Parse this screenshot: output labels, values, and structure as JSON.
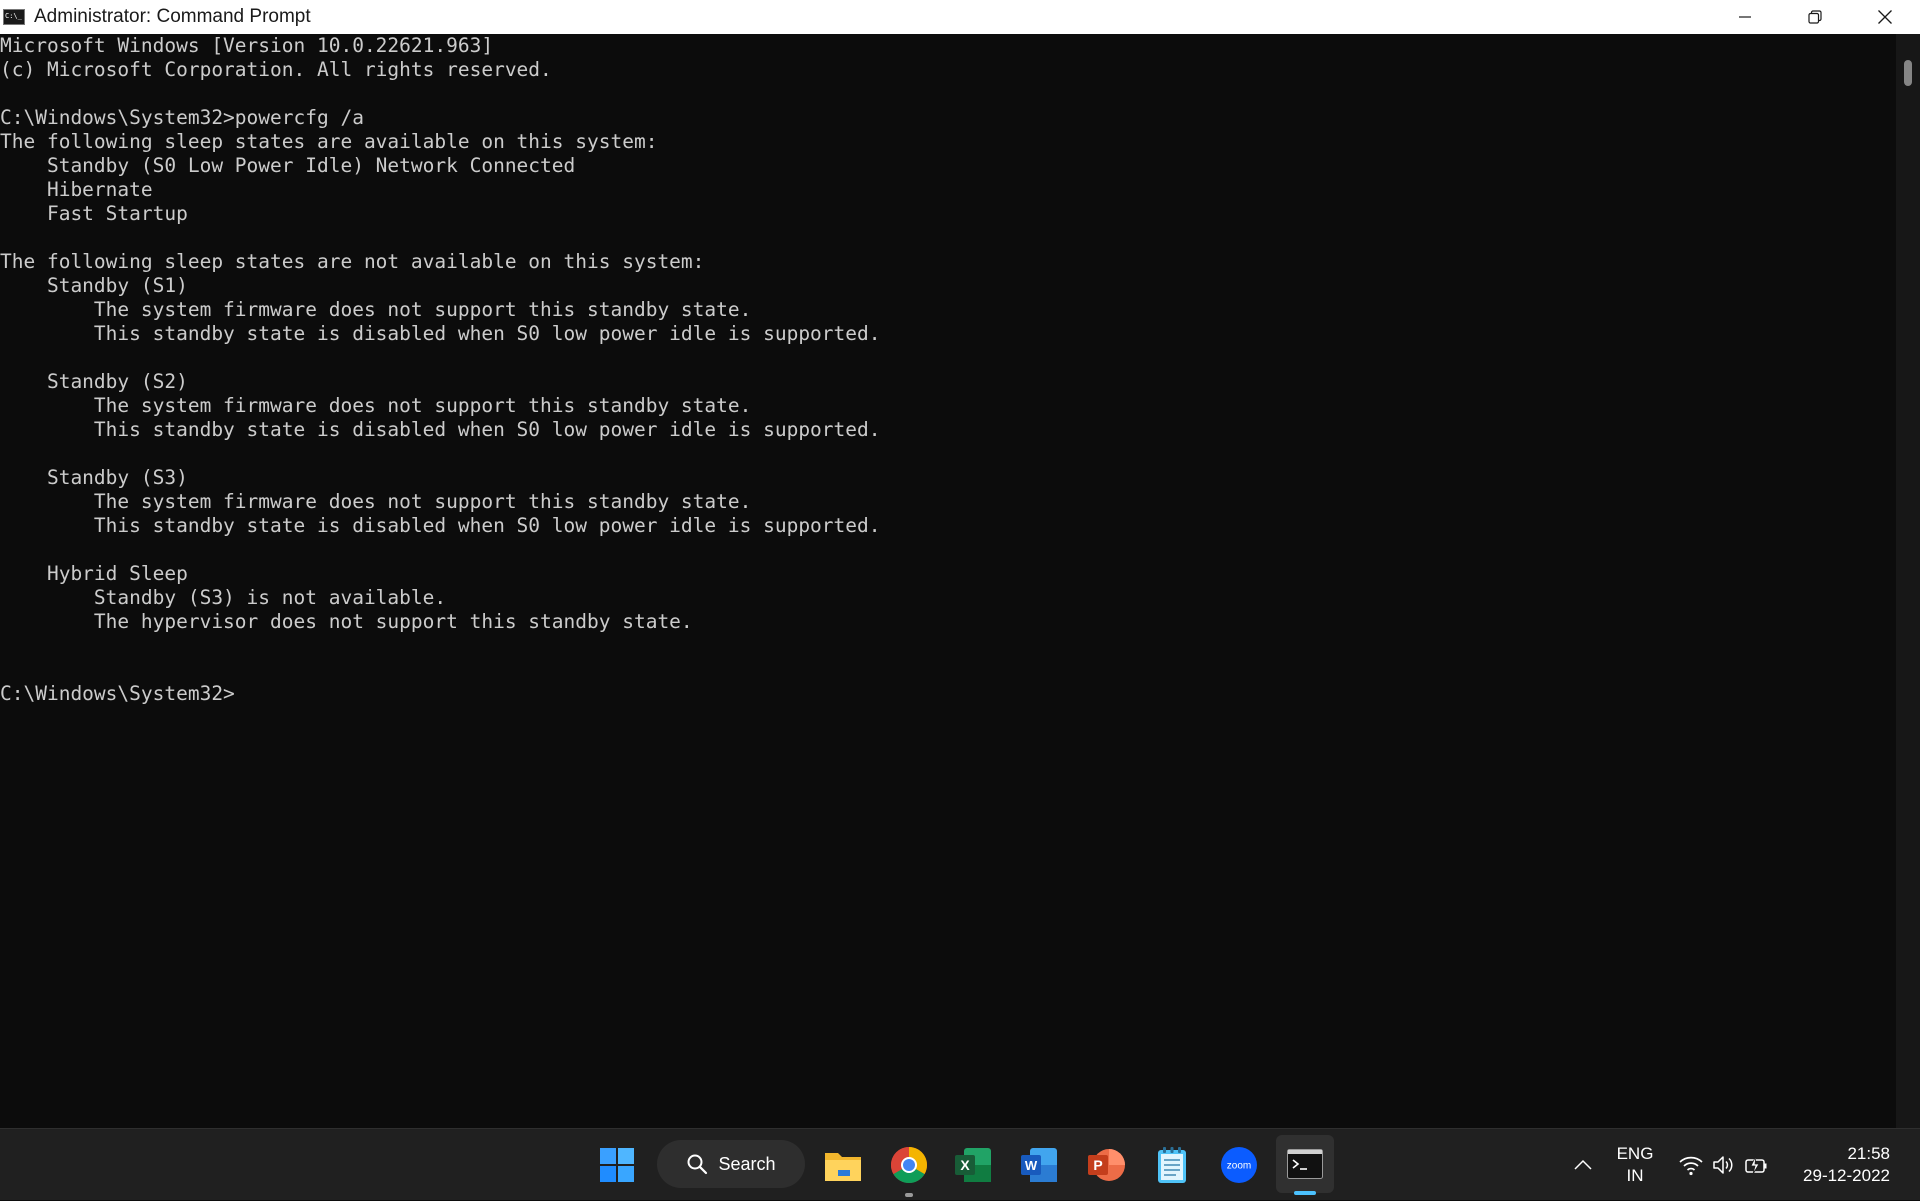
{
  "window": {
    "title": "Administrator: Command Prompt"
  },
  "console": {
    "lines": [
      "Microsoft Windows [Version 10.0.22621.963]",
      "(c) Microsoft Corporation. All rights reserved.",
      "",
      "C:\\Windows\\System32>powercfg /a",
      "The following sleep states are available on this system:",
      "    Standby (S0 Low Power Idle) Network Connected",
      "    Hibernate",
      "    Fast Startup",
      "",
      "The following sleep states are not available on this system:",
      "    Standby (S1)",
      "        The system firmware does not support this standby state.",
      "        This standby state is disabled when S0 low power idle is supported.",
      "",
      "    Standby (S2)",
      "        The system firmware does not support this standby state.",
      "        This standby state is disabled when S0 low power idle is supported.",
      "",
      "    Standby (S3)",
      "        The system firmware does not support this standby state.",
      "        This standby state is disabled when S0 low power idle is supported.",
      "",
      "    Hybrid Sleep",
      "        Standby (S3) is not available.",
      "        The hypervisor does not support this standby state.",
      "",
      "",
      "C:\\Windows\\System32>"
    ]
  },
  "taskbar": {
    "search_label": "Search",
    "apps": [
      {
        "name": "start-icon"
      },
      {
        "name": "file-explorer-icon"
      },
      {
        "name": "chrome-icon"
      },
      {
        "name": "excel-icon",
        "letter": "X"
      },
      {
        "name": "word-icon",
        "letter": "W"
      },
      {
        "name": "powerpoint-icon",
        "letter": "P"
      },
      {
        "name": "notepad-icon"
      },
      {
        "name": "zoom-icon",
        "letter": "zoom"
      },
      {
        "name": "command-prompt-icon"
      }
    ],
    "tray": {
      "language_line1": "ENG",
      "language_line2": "IN",
      "time": "21:58",
      "date": "29-12-2022"
    }
  },
  "colors": {
    "console_bg": "#0c0c0c",
    "console_text": "#cccccc",
    "taskbar_bg": "#202020",
    "accent": "#4cc2ff"
  }
}
